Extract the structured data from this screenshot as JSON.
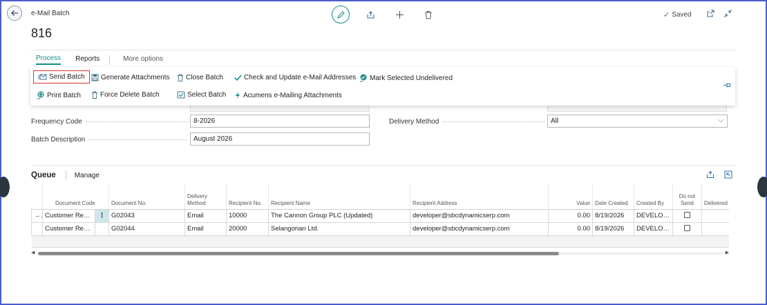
{
  "header": {
    "app_caption": "e-Mail Batch",
    "record_no": "816",
    "saved_label": "Saved"
  },
  "action_tabs": [
    {
      "label": "Process",
      "active": true
    },
    {
      "label": "Reports",
      "active": false
    },
    {
      "label": "More options",
      "active": false
    }
  ],
  "actions": {
    "send_batch": "Send Batch",
    "generate_attachments": "Generate Attachments",
    "close_batch": "Close Batch",
    "check_update": "Check and Update e-Mail Addresses",
    "mark_undelivered": "Mark Selected Undelivered",
    "print_batch": "Print Batch",
    "force_delete": "Force Delete Batch",
    "select_batch": "Select Batch",
    "acumens_attach": "Acumens e-Mailing Attachments"
  },
  "form": {
    "frequency_code_label": "Frequency Code",
    "frequency_code_value": "8-2026",
    "batch_description_label": "Batch Description",
    "batch_description_value": "August 2026",
    "delivery_method_label": "Delivery Method",
    "delivery_method_value": "All"
  },
  "queue": {
    "title": "Queue",
    "manage_label": "Manage",
    "columns": [
      "Document Code",
      "Document No.",
      "Delivery Method",
      "Recipient No.",
      "Recipient Name",
      "Recipient Address",
      "Value",
      "Date Created",
      "Created By",
      "Do not Send",
      "Delivered"
    ],
    "rows": [
      {
        "indicator": "→",
        "document_code": "Customer Rece...",
        "document_no": "G02043",
        "delivery_method": "Email",
        "recipient_no": "10000",
        "recipient_name": "The Cannon Group PLC (Updated)",
        "recipient_address": "developer@sbcdynamicserp.com",
        "value": "0.00",
        "date_created": "8/19/2026",
        "created_by": "DEVELOPER"
      },
      {
        "indicator": "",
        "document_code": "Customer Rece...",
        "document_no": "G02044",
        "delivery_method": "Email",
        "recipient_no": "20000",
        "recipient_name": "Selangorian Ltd.",
        "recipient_address": "developer@sbcdynamicserp.com",
        "value": "0.00",
        "date_created": "8/19/2026",
        "created_by": "DEVELOPER"
      }
    ]
  },
  "icons": {
    "back": "arrow-left-icon",
    "edit": "pencil-icon",
    "share": "share-icon",
    "add": "plus-icon",
    "delete": "trash-icon",
    "open_new": "open-in-new-window-icon",
    "collapse": "collapse-icon",
    "pin": "pin-icon"
  },
  "colors": {
    "accent": "#178a8a",
    "frame_border": "#4a5ccc",
    "highlight_border": "#e03030",
    "selected_cell": "#cfe6ea"
  }
}
